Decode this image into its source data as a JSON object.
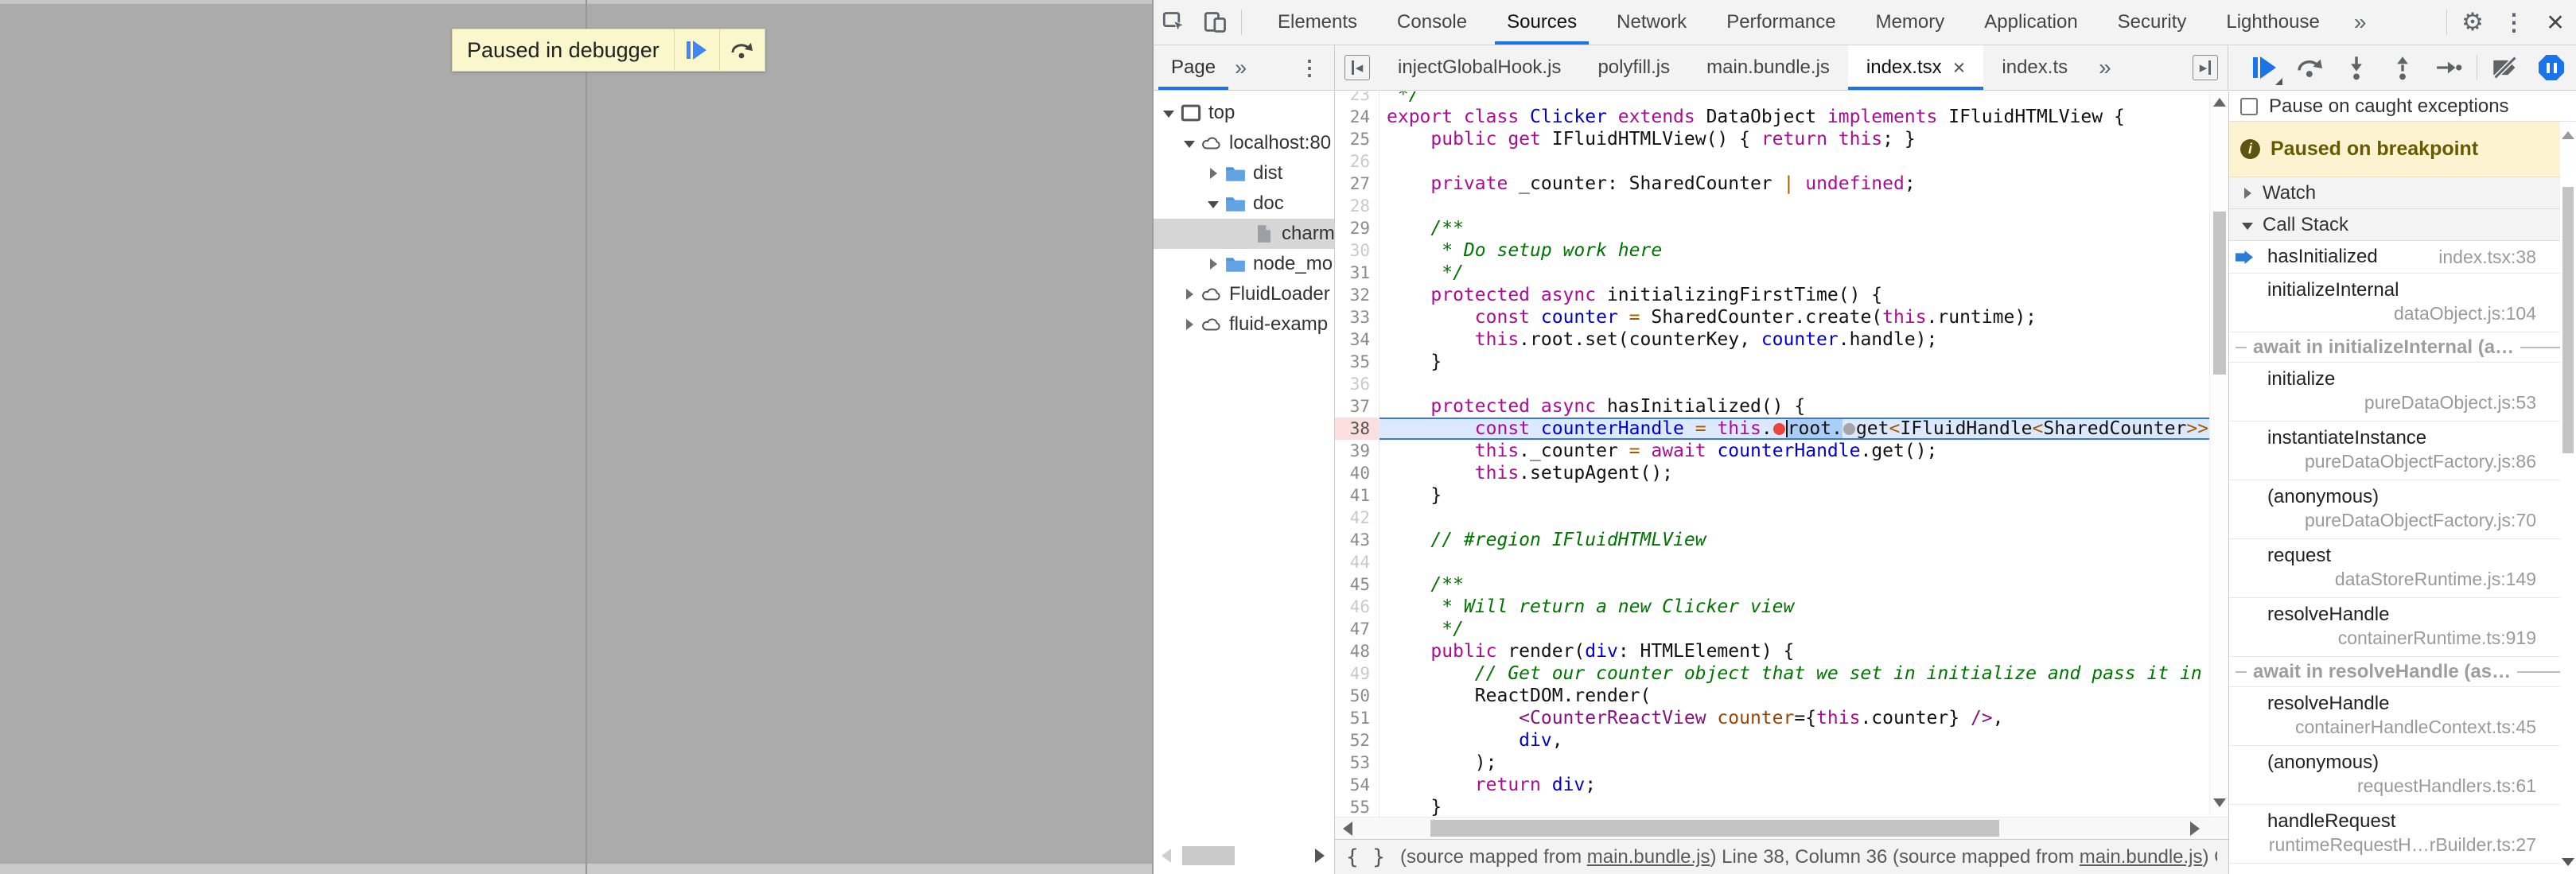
{
  "browser": {
    "paused_label": "Paused in debugger"
  },
  "devtools": {
    "main_toolbar": {
      "tabs": [
        {
          "label": "Elements",
          "active": false
        },
        {
          "label": "Console",
          "active": false
        },
        {
          "label": "Sources",
          "active": true
        },
        {
          "label": "Network",
          "active": false
        },
        {
          "label": "Performance",
          "active": false
        },
        {
          "label": "Memory",
          "active": false
        },
        {
          "label": "Application",
          "active": false
        },
        {
          "label": "Security",
          "active": false
        },
        {
          "label": "Lighthouse",
          "active": false
        }
      ],
      "more_tabs_icon": "»",
      "settings_icon": "⚙",
      "menu_icon": "⋮",
      "close_icon": "×"
    },
    "navigator": {
      "tab": "Page",
      "more_icon": "»",
      "menu_icon": "⋮",
      "tree": [
        {
          "label": "top",
          "icon": "frame",
          "arrow": "open",
          "depth": 0,
          "selected": false
        },
        {
          "label": "localhost:80",
          "icon": "cloud",
          "arrow": "open",
          "depth": 1,
          "selected": false
        },
        {
          "label": "dist",
          "icon": "folder",
          "arrow": "closed",
          "depth": 2,
          "selected": false
        },
        {
          "label": "doc",
          "icon": "folder",
          "arrow": "open",
          "depth": 2,
          "selected": false
        },
        {
          "label": "charmf",
          "icon": "file",
          "arrow": "none",
          "depth": 3,
          "selected": true
        },
        {
          "label": "node_mo",
          "icon": "folder",
          "arrow": "closed",
          "depth": 2,
          "selected": false
        },
        {
          "label": "FluidLoader",
          "icon": "cloud",
          "arrow": "closed",
          "depth": 1,
          "selected": false
        },
        {
          "label": "fluid-examp",
          "icon": "cloud",
          "arrow": "closed",
          "depth": 1,
          "selected": false
        }
      ]
    },
    "file_tabs": {
      "collapse_icon": "◂",
      "expand_icon": "▸",
      "more_icon": "»",
      "close_icon": "×",
      "tabs": [
        {
          "label": "injectGlobalHook.js",
          "active": false,
          "closable": false
        },
        {
          "label": "polyfill.js",
          "active": false,
          "closable": false
        },
        {
          "label": "main.bundle.js",
          "active": false,
          "closable": false
        },
        {
          "label": "index.tsx",
          "active": true,
          "closable": true
        },
        {
          "label": "index.ts",
          "active": false,
          "closable": false
        }
      ]
    },
    "editor": {
      "lines": [
        {
          "n": 23,
          "dim": true,
          "segs": [
            [
              "c",
              " */"
            ]
          ]
        },
        {
          "n": 24,
          "dim": false,
          "segs": [
            [
              "k",
              "export class "
            ],
            [
              "d",
              "Clicker"
            ],
            [
              "k",
              " extends "
            ],
            [
              "p",
              "DataObject"
            ],
            [
              "k",
              " implements "
            ],
            [
              "p",
              "IFluidHTMLView {"
            ]
          ]
        },
        {
          "n": 25,
          "dim": false,
          "segs": [
            [
              "k",
              "    public get "
            ],
            [
              "p",
              "IFluidHTMLView() { "
            ],
            [
              "k",
              "return this"
            ],
            [
              "p",
              "; }"
            ]
          ]
        },
        {
          "n": 26,
          "dim": true,
          "segs": []
        },
        {
          "n": 27,
          "dim": false,
          "segs": [
            [
              "k",
              "    private "
            ],
            [
              "p",
              "_counter: SharedCounter "
            ],
            [
              "o",
              "| "
            ],
            [
              "k",
              "undefined"
            ],
            [
              "p",
              ";"
            ]
          ]
        },
        {
          "n": 28,
          "dim": true,
          "segs": []
        },
        {
          "n": 29,
          "dim": false,
          "segs": [
            [
              "c",
              "    /**"
            ]
          ]
        },
        {
          "n": 30,
          "dim": true,
          "segs": [
            [
              "c",
              "     * Do setup work here"
            ]
          ]
        },
        {
          "n": 31,
          "dim": false,
          "segs": [
            [
              "c",
              "     */"
            ]
          ]
        },
        {
          "n": 32,
          "dim": false,
          "segs": [
            [
              "k",
              "    protected async "
            ],
            [
              "p",
              "initializingFirstTime() {"
            ]
          ]
        },
        {
          "n": 33,
          "dim": false,
          "segs": [
            [
              "p",
              "        "
            ],
            [
              "k",
              "const "
            ],
            [
              "d",
              "counter"
            ],
            [
              "o",
              " = "
            ],
            [
              "p",
              "SharedCounter.create("
            ],
            [
              "k",
              "this"
            ],
            [
              "p",
              ".runtime);"
            ]
          ]
        },
        {
          "n": 34,
          "dim": false,
          "segs": [
            [
              "p",
              "        "
            ],
            [
              "k",
              "this"
            ],
            [
              "p",
              ".root.set(counterKey, "
            ],
            [
              "d",
              "counter"
            ],
            [
              "p",
              ".handle);"
            ]
          ]
        },
        {
          "n": 35,
          "dim": false,
          "segs": [
            [
              "p",
              "    }"
            ]
          ]
        },
        {
          "n": 36,
          "dim": true,
          "segs": []
        },
        {
          "n": 37,
          "dim": false,
          "segs": [
            [
              "k",
              "    protected async "
            ],
            [
              "p",
              "hasInitialized() {"
            ]
          ]
        },
        {
          "n": 38,
          "dim": false,
          "current": true,
          "breakpoint": true,
          "segs": [
            [
              "p",
              "        "
            ],
            [
              "k",
              "const "
            ],
            [
              "d",
              "counterHandle"
            ],
            [
              "o",
              " = "
            ],
            [
              "k",
              "this"
            ],
            [
              "p",
              "."
            ],
            [
              "RDOT",
              ""
            ],
            [
              "CARET",
              ""
            ],
            [
              "SEL",
              "root."
            ],
            [
              "GDOT",
              ""
            ],
            [
              "p",
              "get"
            ],
            [
              "o",
              "<"
            ],
            [
              "p",
              "IFluidHandle"
            ],
            [
              "o",
              "<"
            ],
            [
              "p",
              "SharedCounter"
            ],
            [
              "o",
              ">>("
            ]
          ]
        },
        {
          "n": 39,
          "dim": false,
          "segs": [
            [
              "p",
              "        "
            ],
            [
              "k",
              "this"
            ],
            [
              "p",
              "._counter "
            ],
            [
              "o",
              "= "
            ],
            [
              "k",
              "await "
            ],
            [
              "d",
              "counterHandle"
            ],
            [
              "p",
              ".get();"
            ]
          ]
        },
        {
          "n": 40,
          "dim": false,
          "segs": [
            [
              "p",
              "        "
            ],
            [
              "k",
              "this"
            ],
            [
              "p",
              ".setupAgent();"
            ]
          ]
        },
        {
          "n": 41,
          "dim": false,
          "segs": [
            [
              "p",
              "    }"
            ]
          ]
        },
        {
          "n": 42,
          "dim": true,
          "segs": []
        },
        {
          "n": 43,
          "dim": false,
          "segs": [
            [
              "c",
              "    // #region IFluidHTMLView"
            ]
          ]
        },
        {
          "n": 44,
          "dim": true,
          "segs": []
        },
        {
          "n": 45,
          "dim": false,
          "segs": [
            [
              "c",
              "    /**"
            ]
          ]
        },
        {
          "n": 46,
          "dim": true,
          "segs": [
            [
              "c",
              "     * Will return a new Clicker view"
            ]
          ]
        },
        {
          "n": 47,
          "dim": false,
          "segs": [
            [
              "c",
              "     */"
            ]
          ]
        },
        {
          "n": 48,
          "dim": false,
          "segs": [
            [
              "k",
              "    public "
            ],
            [
              "p",
              "render("
            ],
            [
              "d",
              "div"
            ],
            [
              "p",
              ": HTMLElement) {"
            ]
          ]
        },
        {
          "n": 49,
          "dim": true,
          "segs": [
            [
              "c",
              "        // Get our counter object that we set in initialize and pass it in to"
            ]
          ]
        },
        {
          "n": 50,
          "dim": false,
          "segs": [
            [
              "p",
              "        ReactDOM.render("
            ]
          ]
        },
        {
          "n": 51,
          "dim": false,
          "segs": [
            [
              "p",
              "            "
            ],
            [
              "t",
              "<CounterReactView "
            ],
            [
              "a",
              "counter"
            ],
            [
              "p",
              "={"
            ],
            [
              "k",
              "this"
            ],
            [
              "p",
              ".counter} "
            ],
            [
              "t",
              "/>"
            ],
            [
              "p",
              ","
            ]
          ]
        },
        {
          "n": 52,
          "dim": false,
          "segs": [
            [
              "p",
              "            "
            ],
            [
              "d",
              "div"
            ],
            [
              "p",
              ","
            ]
          ]
        },
        {
          "n": 53,
          "dim": false,
          "segs": [
            [
              "p",
              "        );"
            ]
          ]
        },
        {
          "n": 54,
          "dim": false,
          "segs": [
            [
              "k",
              "        return "
            ],
            [
              "d",
              "div"
            ],
            [
              "p",
              ";"
            ]
          ]
        },
        {
          "n": 55,
          "dim": false,
          "segs": [
            [
              "p",
              "    }"
            ]
          ]
        }
      ]
    },
    "right_panel": {
      "pause_on_caught_label": "Pause on caught exceptions",
      "paused_banner": "Paused on breakpoint",
      "watch_label": "Watch",
      "call_stack_label": "Call Stack",
      "frames": [
        {
          "fn": "hasInitialized",
          "file": "index.tsx:38",
          "active": true,
          "inline": true
        },
        {
          "fn": "initializeInternal",
          "file": "dataObject.js:104"
        },
        {
          "type": "async",
          "label": "await in initializeInternal (a…"
        },
        {
          "fn": "initialize",
          "file": "pureDataObject.js:53"
        },
        {
          "fn": "instantiateInstance",
          "file": "pureDataObjectFactory.js:86"
        },
        {
          "fn": "(anonymous)",
          "file": "pureDataObjectFactory.js:70"
        },
        {
          "fn": "request",
          "file": "dataStoreRuntime.js:149"
        },
        {
          "fn": "resolveHandle",
          "file": "containerRuntime.ts:919"
        },
        {
          "type": "async",
          "label": "await in resolveHandle (as…"
        },
        {
          "fn": "resolveHandle",
          "file": "containerHandleContext.ts:45"
        },
        {
          "fn": "(anonymous)",
          "file": "requestHandlers.ts:61"
        },
        {
          "fn": "handleRequest",
          "file": "runtimeRequestH…rBuilder.ts:27"
        }
      ]
    },
    "status_bar": {
      "format_icon": "{ }",
      "parts": [
        {
          "text": "(source mapped from ",
          "link": false
        },
        {
          "text": "main.bundle.js",
          "link": true
        },
        {
          "text": ") Line 38, Column 36 (source mapped from ",
          "link": false
        },
        {
          "text": "main.bundle.js",
          "link": true
        },
        {
          "text": ") Co",
          "link": false
        }
      ]
    }
  },
  "colors": {
    "accent": "#1a73e8",
    "breakpoint_red": "#e8453c",
    "paused_banner_bg": "#fdf3d0",
    "paused_banner_text": "#665a00",
    "keyword": "#aa0d91",
    "definition": "#0000cc",
    "comment": "#007400",
    "operator": "#a45a00",
    "tag": "#881280",
    "attribute": "#994500"
  }
}
